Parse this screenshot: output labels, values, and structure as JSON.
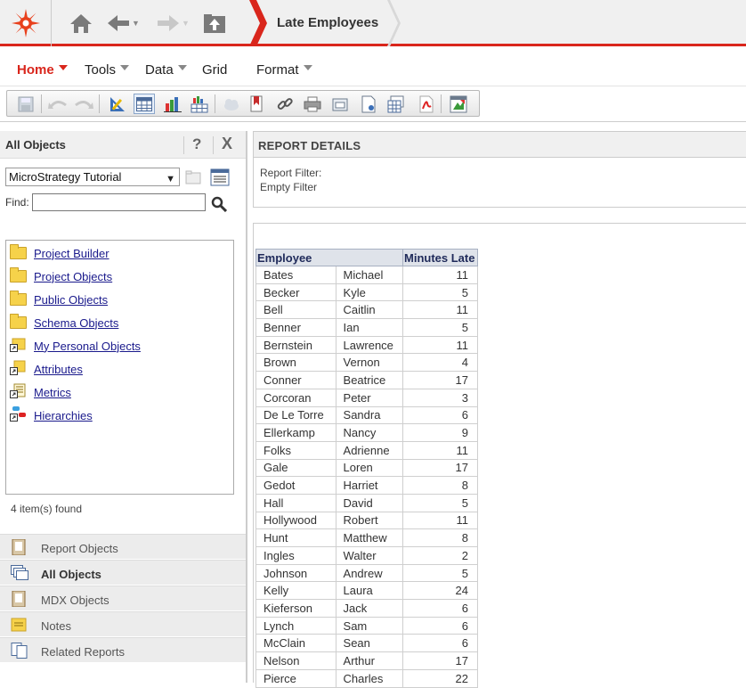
{
  "topbar": {
    "breadcrumb": "Late Employees",
    "icons": [
      "logo-icon",
      "home-icon",
      "back-icon",
      "forward-icon",
      "up-folder-icon"
    ]
  },
  "menu": {
    "items": [
      "Home",
      "Tools",
      "Data",
      "Grid",
      "Format"
    ]
  },
  "toolbar": {
    "buttons": [
      "save-icon",
      "undo-icon",
      "redo-icon",
      "design-mode-icon",
      "grid-view-icon",
      "graph-view-icon",
      "grid-graph-view-icon",
      "share-icon",
      "bookmark-icon",
      "link-icon",
      "print-icon",
      "export-icon",
      "export-pdf-icon",
      "export-excel-icon",
      "pdf-icon",
      "add-to-history-icon"
    ]
  },
  "left_panel": {
    "title": "All Objects",
    "help": "?",
    "close": "X",
    "project": "MicroStrategy Tutorial",
    "find_label": "Find:",
    "find_value": "",
    "objects": [
      "Project Builder",
      "Project Objects",
      "Public Objects",
      "Schema Objects",
      "My Personal Objects",
      "Attributes",
      "Metrics",
      "Hierarchies"
    ],
    "status": "4 item(s) found",
    "accordion": [
      "Report Objects",
      "All Objects",
      "MDX Objects",
      "Notes",
      "Related Reports"
    ]
  },
  "details": {
    "title": "REPORT DETAILS",
    "filter_label": "Report Filter:",
    "filter_value": "Empty Filter"
  },
  "report": {
    "headers": {
      "employee": "Employee",
      "minutes": "Minutes Late"
    },
    "rows": [
      [
        "Bates",
        "Michael",
        "11"
      ],
      [
        "Becker",
        "Kyle",
        "5"
      ],
      [
        "Bell",
        "Caitlin",
        "11"
      ],
      [
        "Benner",
        "Ian",
        "5"
      ],
      [
        "Bernstein",
        "Lawrence",
        "11"
      ],
      [
        "Brown",
        "Vernon",
        "4"
      ],
      [
        "Conner",
        "Beatrice",
        "17"
      ],
      [
        "Corcoran",
        "Peter",
        "3"
      ],
      [
        "De Le Torre",
        "Sandra",
        "6"
      ],
      [
        "Ellerkamp",
        "Nancy",
        "9"
      ],
      [
        "Folks",
        "Adrienne",
        "11"
      ],
      [
        "Gale",
        "Loren",
        "17"
      ],
      [
        "Gedot",
        "Harriet",
        "8"
      ],
      [
        "Hall",
        "David",
        "5"
      ],
      [
        "Hollywood",
        "Robert",
        "11"
      ],
      [
        "Hunt",
        "Matthew",
        "8"
      ],
      [
        "Ingles",
        "Walter",
        "2"
      ],
      [
        "Johnson",
        "Andrew",
        "5"
      ],
      [
        "Kelly",
        "Laura",
        "24"
      ],
      [
        "Kieferson",
        "Jack",
        "6"
      ],
      [
        "Lynch",
        "Sam",
        "6"
      ],
      [
        "McClain",
        "Sean",
        "6"
      ],
      [
        "Nelson",
        "Arthur",
        "17"
      ],
      [
        "Pierce",
        "Charles",
        "22"
      ]
    ]
  },
  "colors": {
    "accent": "#d9261c",
    "header_bg": "#dfe3ea",
    "link": "#1a1a8c"
  }
}
